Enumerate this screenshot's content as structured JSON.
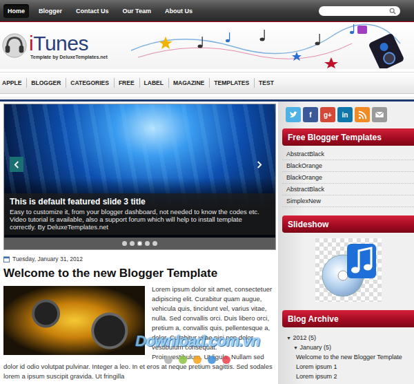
{
  "top_nav": {
    "items": [
      {
        "label": "Home",
        "selected": true
      },
      {
        "label": "Blogger",
        "selected": false
      },
      {
        "label": "Contact Us",
        "selected": false
      },
      {
        "label": "Our Team",
        "selected": false
      },
      {
        "label": "About Us",
        "selected": false
      }
    ]
  },
  "logo": {
    "brand_accent": "i",
    "brand_rest": "Tunes",
    "tagline": "Template by DeluxeTemplates.net"
  },
  "category_nav": {
    "items": [
      "APPLE",
      "BLOGGER",
      "CATEGORIES",
      "FREE",
      "LABEL",
      "MAGAZINE",
      "TEMPLATES",
      "TEST"
    ]
  },
  "slider": {
    "title": "This is default featured slide 3 title",
    "text": "Easy to customize it, from your blogger dashboard, not needed to know the codes etc. Video tutorial is available, also a support forum which will help to install template correctly. By DeluxeTemplates.net",
    "dots": [
      {
        "selected": false
      },
      {
        "selected": false
      },
      {
        "selected": true
      },
      {
        "selected": false
      },
      {
        "selected": false
      }
    ]
  },
  "post": {
    "date": "Tuesday, January 31, 2012",
    "title": "Welcome to the new Blogger Template",
    "paragraphs": [
      "Lorem ipsum dolor sit amet, consectetuer adipiscing elit. Curabitur quam augue, vehicula quis, tincidunt vel, varius vitae, nulla. Sed convallis orci. Duis libero orci, pretium a, convallis quis, pellentesque a, dolor. Curabitur vitae nisi non dolor vestibulum consequat.",
      "Proin vestibulum. Ut ligula. Nullam sed dolor id odio volutpat pulvinar. Integer a leo. In et eros at neque pretium sagittis. Sed sodales lorem a ipsum suscipit gravida. Ut fringilla"
    ]
  },
  "sidebar": {
    "social": [
      {
        "kind": "twitter",
        "color": "#4fb2e6"
      },
      {
        "kind": "facebook",
        "glyph": "f",
        "color": "#3b5998"
      },
      {
        "kind": "googleplus",
        "glyph": "g+",
        "color": "#d34836"
      },
      {
        "kind": "linkedin",
        "glyph": "in",
        "color": "#0e76a8"
      },
      {
        "kind": "rss",
        "color": "#f08a24"
      },
      {
        "kind": "email",
        "color": "#9a9a9a"
      }
    ],
    "widgets": [
      {
        "kind": "links",
        "title": "Free Blogger Templates",
        "items": [
          "AbstractBlack",
          "BlackOrange",
          "BlackOrange",
          "AbstractBlack",
          "SimplexNew"
        ]
      },
      {
        "kind": "slideshow",
        "title": "Slideshow"
      },
      {
        "kind": "archive",
        "title": "Blog Archive",
        "years": [
          {
            "toggle": "▼",
            "label": "2012",
            "count": "(5)",
            "expanded": true,
            "months": [
              {
                "toggle": "▼",
                "label": "January",
                "count": "(5)",
                "expanded": true,
                "posts": [
                  "Welcome to the new Blogger Template",
                  "Lorem ipsum 1",
                  "Lorem ipsum 2"
                ]
              }
            ]
          }
        ]
      }
    ]
  },
  "watermark": {
    "text": "Download.com.vn",
    "dots": [
      {
        "color": "#b0b0b0"
      },
      {
        "color": "#8cc63f"
      },
      {
        "color": "#f7a21b"
      },
      {
        "color": "#3b8fd9"
      },
      {
        "color": "#e8434f"
      }
    ]
  }
}
